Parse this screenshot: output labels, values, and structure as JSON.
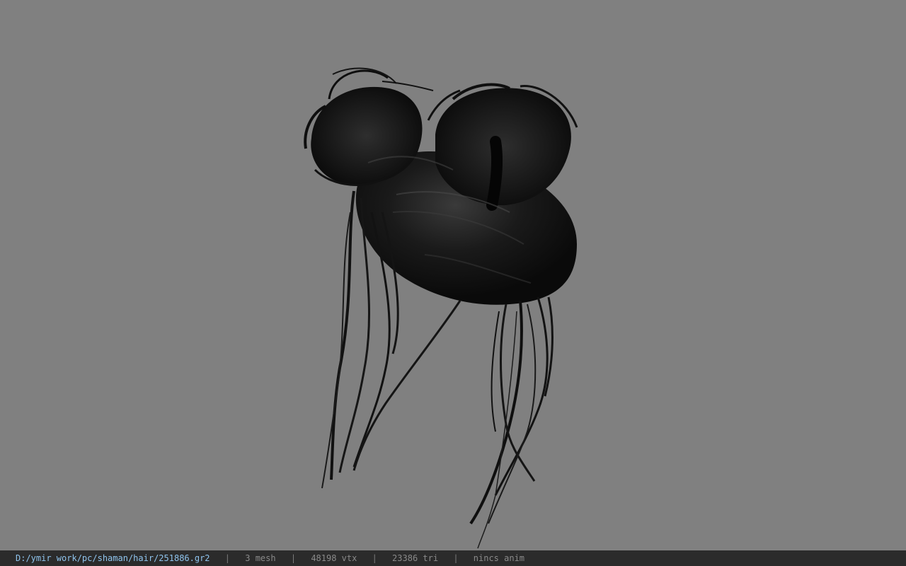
{
  "viewport": {
    "background_color": "#808080",
    "model": {
      "name": "hair-model",
      "color": "#0f0f0f",
      "highlight_color": "#3a3a3a"
    }
  },
  "status_bar": {
    "file_path": "D:/ymir work/pc/shaman/hair/251886.gr2",
    "mesh_count": "3 mesh",
    "vertex_count": "48198 vtx",
    "triangle_count": "23386 tri",
    "anim_status": "nincs anim",
    "separator": "|",
    "path_color": "#8fc4ee",
    "text_color": "#8a8a8a"
  }
}
